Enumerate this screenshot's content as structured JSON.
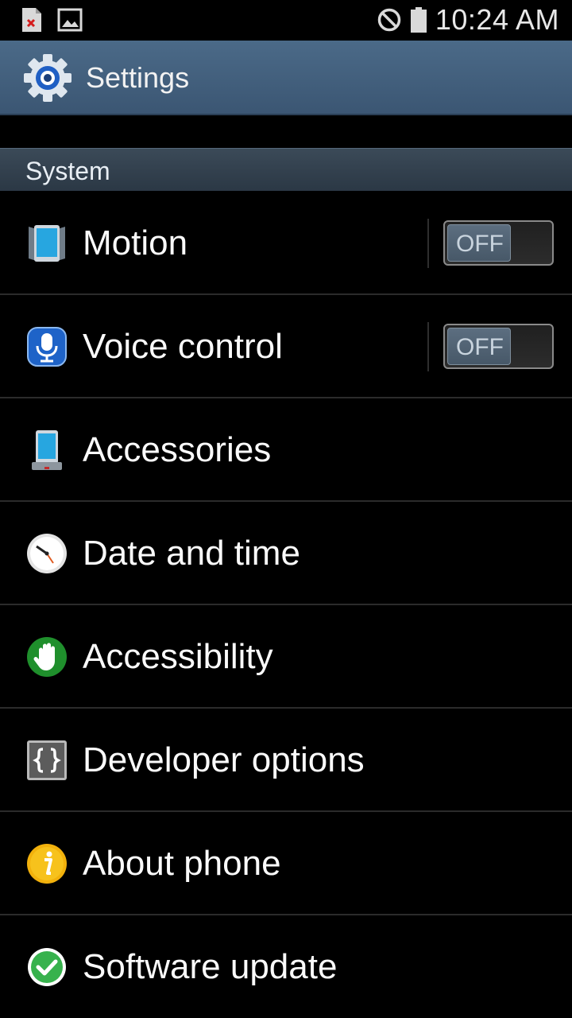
{
  "status_bar": {
    "time": "10:24 AM",
    "left_icons": [
      "file-error-icon",
      "image-icon"
    ],
    "right_icons": [
      "no-signal-icon",
      "battery-icon"
    ]
  },
  "action_bar": {
    "icon": "settings-gear-icon",
    "title": "Settings"
  },
  "section": {
    "title": "System"
  },
  "items": [
    {
      "label": "Motion",
      "icon": "motion-phone-icon",
      "toggle": "OFF"
    },
    {
      "label": "Voice control",
      "icon": "microphone-icon",
      "toggle": "OFF"
    },
    {
      "label": "Accessories",
      "icon": "phone-dock-icon"
    },
    {
      "label": "Date and time",
      "icon": "clock-icon"
    },
    {
      "label": "Accessibility",
      "icon": "hand-icon"
    },
    {
      "label": "Developer options",
      "icon": "braces-icon"
    },
    {
      "label": "About phone",
      "icon": "info-icon"
    },
    {
      "label": "Software update",
      "icon": "checkmark-icon"
    }
  ],
  "colors": {
    "background": "#000000",
    "action_bar": "#45617e",
    "section_header": "#34424f",
    "divider": "#2b2b2b"
  }
}
